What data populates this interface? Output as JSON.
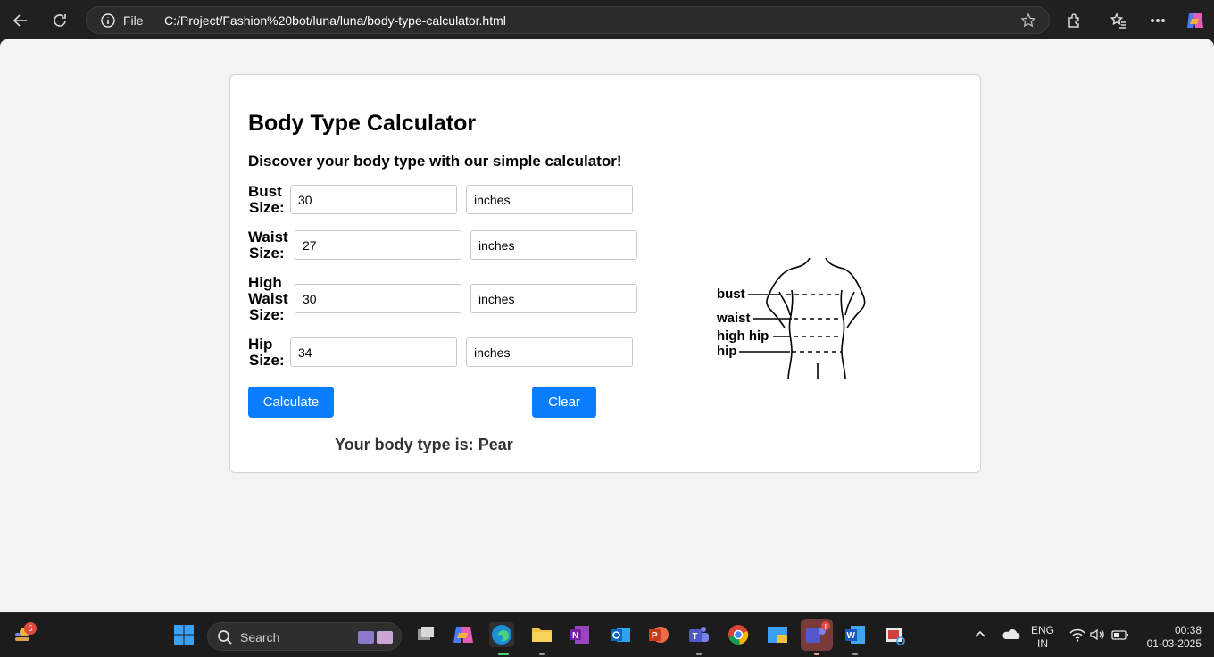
{
  "browser": {
    "scheme_label": "File",
    "url": "C:/Project/Fashion%20bot/luna/luna/body-type-calculator.html"
  },
  "calculator": {
    "title": "Body Type Calculator",
    "subtitle": "Discover your body type with our simple calculator!",
    "fields": [
      {
        "label_line1": "Bust",
        "label_line2": "Size:",
        "value": "30",
        "unit": "inches"
      },
      {
        "label_line1": "Waist",
        "label_line2": "Size:",
        "value": "27",
        "unit": "inches"
      },
      {
        "label_line1": "High",
        "label_line2": "Waist",
        "label_line3": "Size:",
        "value": "30",
        "unit": "inches"
      },
      {
        "label_line1": "Hip",
        "label_line2": "Size:",
        "value": "34",
        "unit": "inches"
      }
    ],
    "calculate_label": "Calculate",
    "clear_label": "Clear",
    "result_prefix": "Your body type is: ",
    "result_value": "Pear",
    "figure_labels": {
      "bust": "bust",
      "waist": "waist",
      "high_hip": "high hip",
      "hip": "hip"
    }
  },
  "taskbar": {
    "widgets_badge": "5",
    "search_label": "Search",
    "language_line1": "ENG",
    "language_line2": "IN",
    "time": "00:38",
    "date": "01-03-2025"
  },
  "colors": {
    "accent": "#0a7cff",
    "page_bg": "#f3f3f3",
    "card_bg": "#ffffff"
  }
}
